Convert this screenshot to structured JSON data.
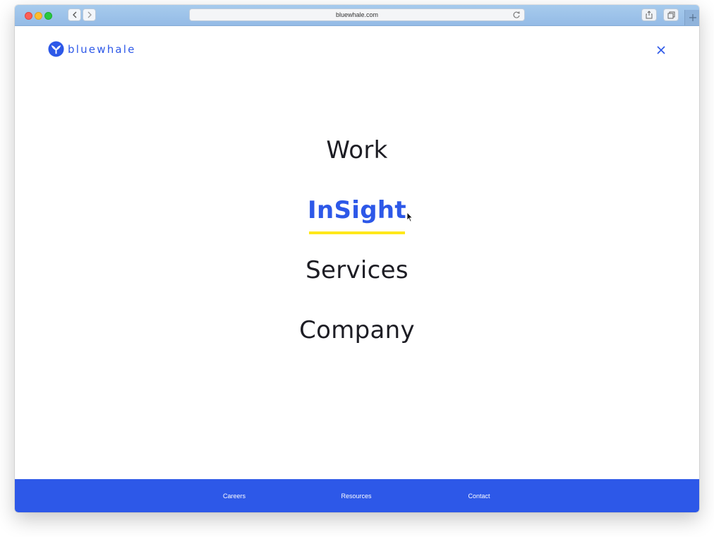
{
  "browser": {
    "url": "bluewhale.com"
  },
  "brand": {
    "name": "bluewhale",
    "color": "#2d58e8",
    "accent": "#ffe81a"
  },
  "menu": {
    "items": [
      {
        "label": "Work",
        "active": false
      },
      {
        "label": "InSight",
        "active": true
      },
      {
        "label": "Services",
        "active": false
      },
      {
        "label": "Company",
        "active": false
      }
    ]
  },
  "footer": {
    "links": [
      "Careers",
      "Resources",
      "Contact"
    ]
  },
  "icons": {
    "close": "close-icon",
    "logo": "whale-tail-logo-icon"
  }
}
